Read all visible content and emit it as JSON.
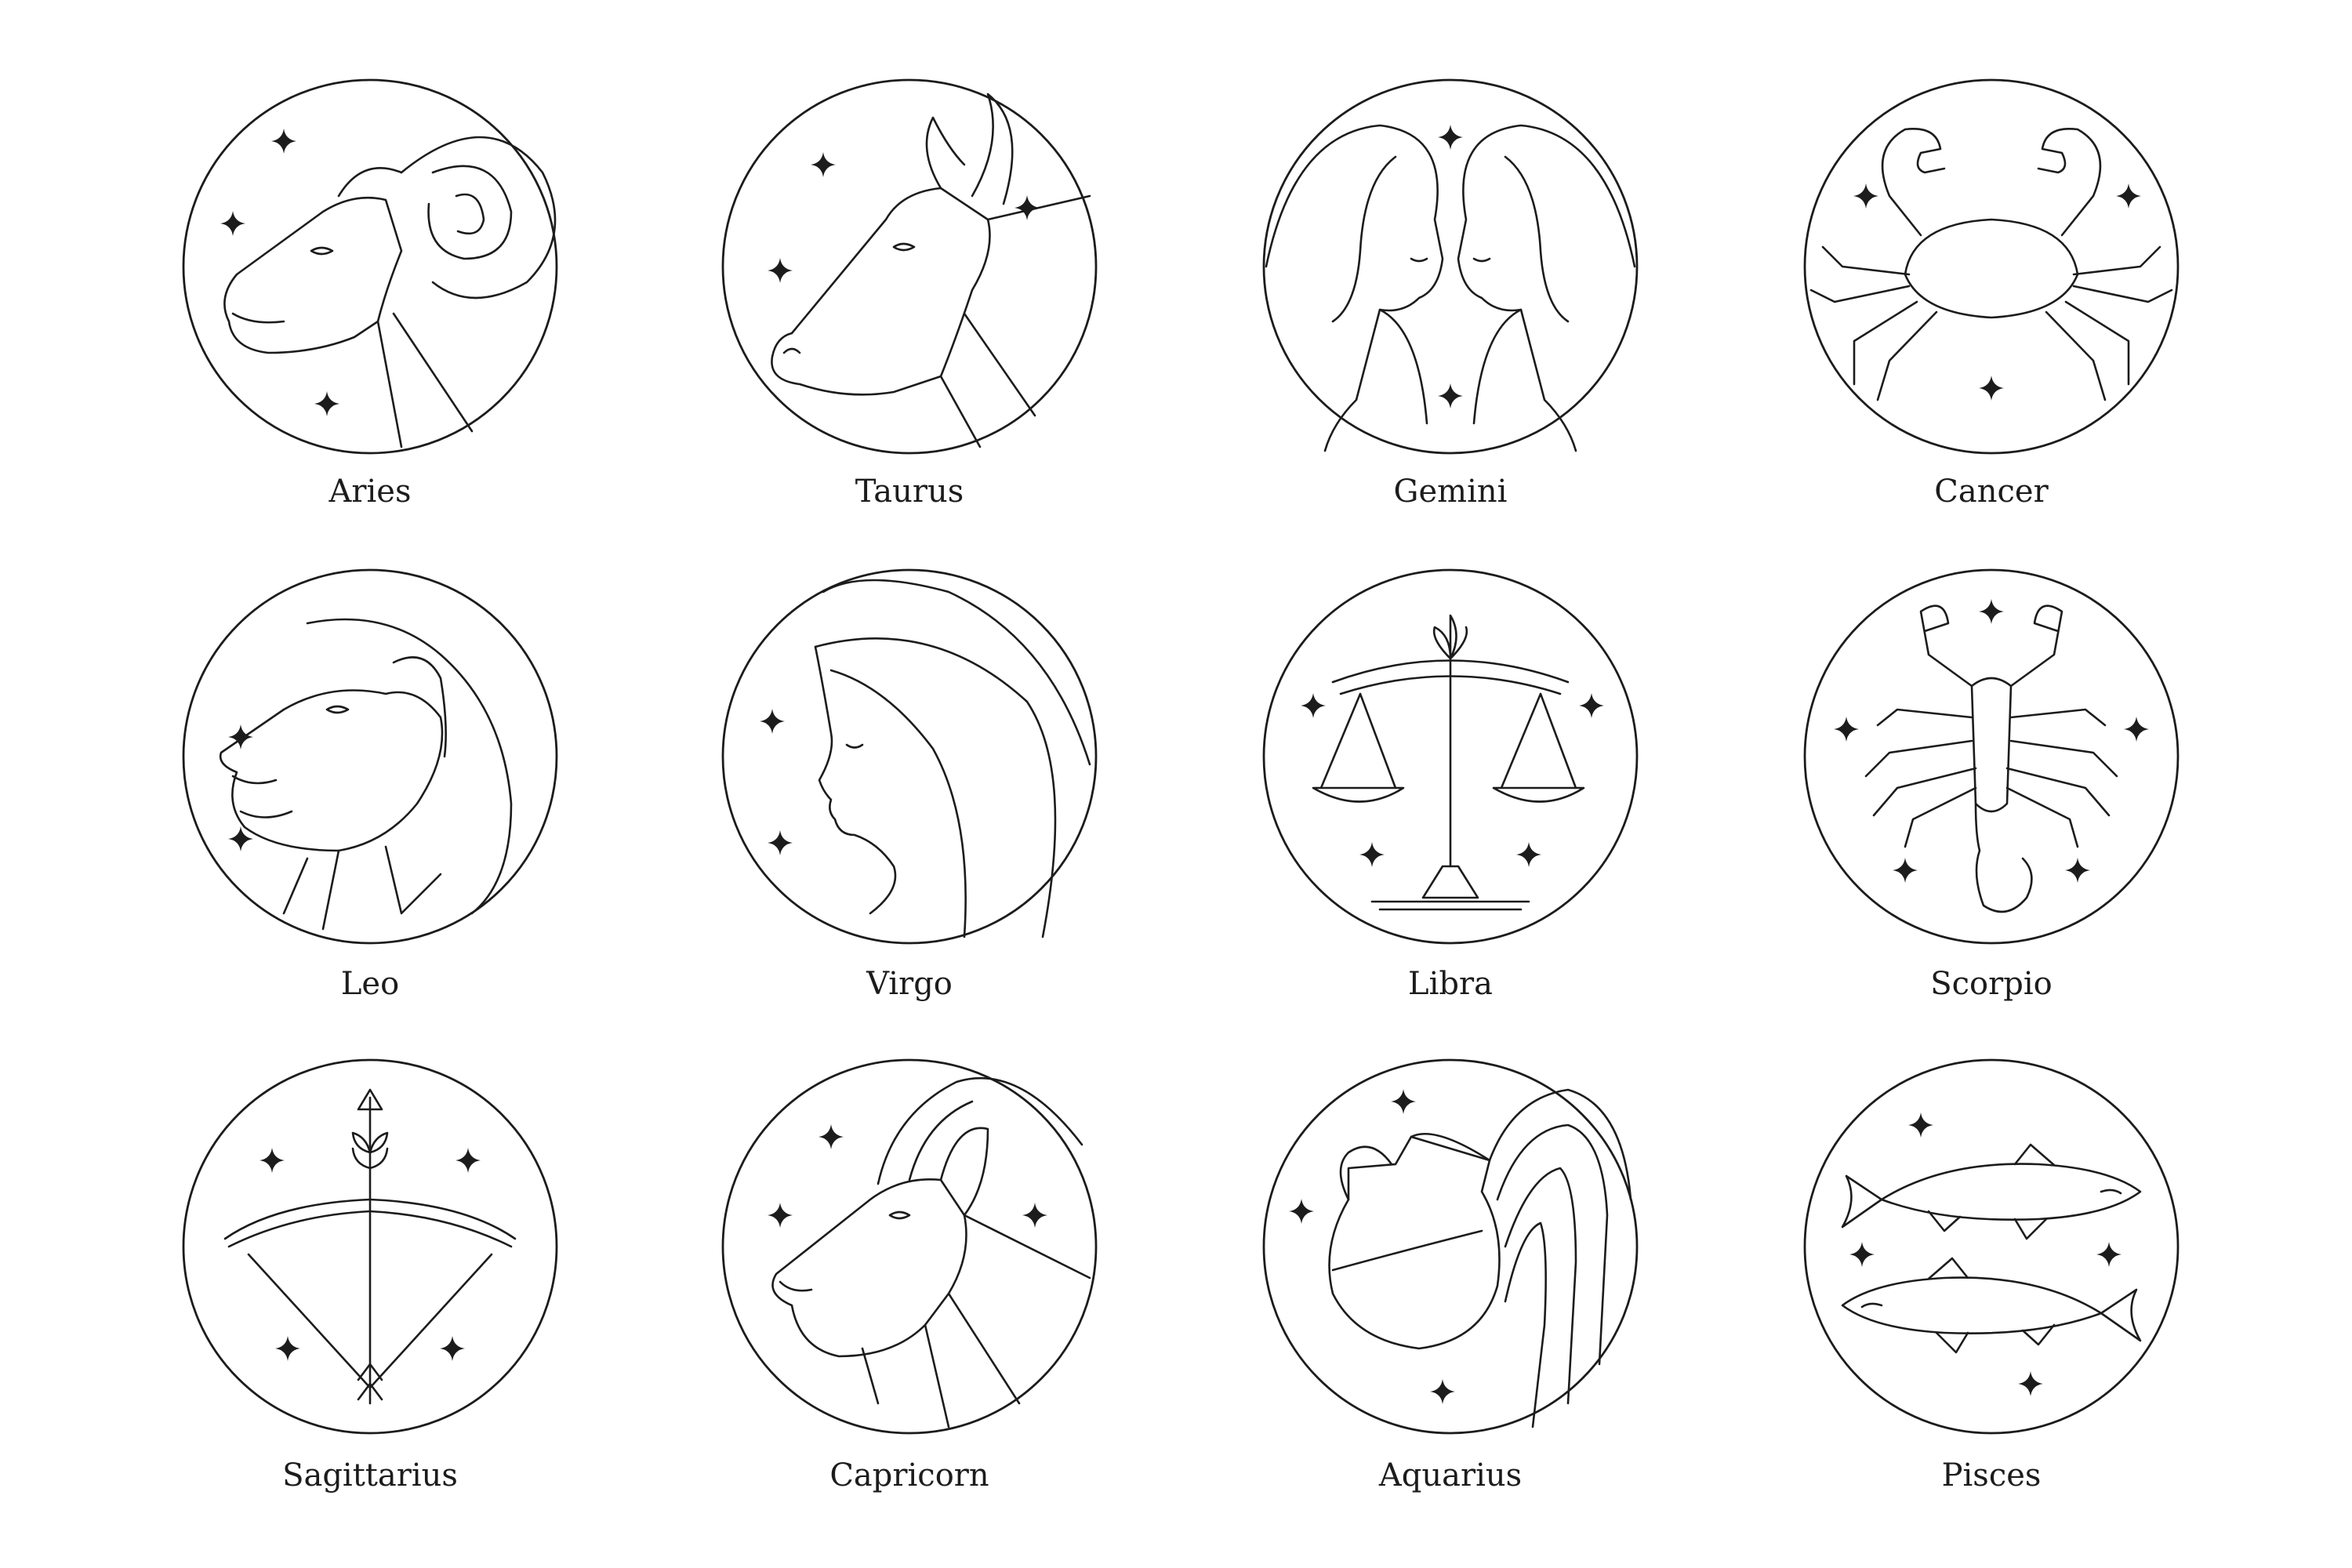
{
  "signs": [
    {
      "label": "Aries",
      "icon": "ram-icon"
    },
    {
      "label": "Taurus",
      "icon": "bull-icon"
    },
    {
      "label": "Gemini",
      "icon": "twins-icon"
    },
    {
      "label": "Cancer",
      "icon": "crab-icon"
    },
    {
      "label": "Leo",
      "icon": "lion-icon"
    },
    {
      "label": "Virgo",
      "icon": "maiden-icon"
    },
    {
      "label": "Libra",
      "icon": "scales-icon"
    },
    {
      "label": "Scorpio",
      "icon": "scorpion-icon"
    },
    {
      "label": "Sagittarius",
      "icon": "bow-and-arrow-icon"
    },
    {
      "label": "Capricorn",
      "icon": "goat-icon"
    },
    {
      "label": "Aquarius",
      "icon": "water-jug-icon"
    },
    {
      "label": "Pisces",
      "icon": "fish-icon"
    }
  ],
  "colors": {
    "line": "#1c1c1c",
    "background": "#ffffff"
  }
}
